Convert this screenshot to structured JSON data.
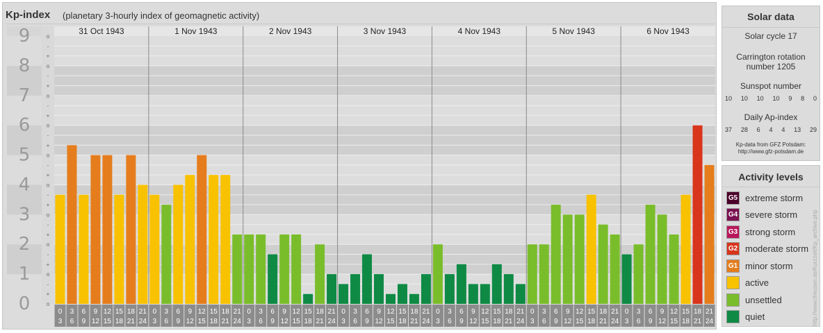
{
  "header": {
    "title": "Kp-index",
    "subtitle": "(planetary 3-hourly index of geomagnetic activity)"
  },
  "chart_data": {
    "type": "bar",
    "title": "Kp-index",
    "subtitle": "(planetary 3-hourly index of geomagnetic activity)",
    "ylim": [
      0,
      9
    ],
    "y_ticks": [
      "0",
      "1",
      "2",
      "3",
      "4",
      "5",
      "6",
      "7",
      "8",
      "9"
    ],
    "minor_tick_labels": [
      "o",
      "+",
      "-",
      "o",
      "+",
      "-",
      "o",
      "+",
      "-",
      "o",
      "+",
      "-",
      "o",
      "+",
      "-",
      "o",
      "+",
      "-",
      "o",
      "+",
      "-",
      "o",
      "+",
      "-",
      "o",
      "+",
      "-",
      "o"
    ],
    "days": [
      "31 Oct 1943",
      "1 Nov 1943",
      "2 Nov 1943",
      "3 Nov 1943",
      "4 Nov 1943",
      "5 Nov 1943",
      "6 Nov 1943"
    ],
    "interval_start_labels": [
      "0",
      "3",
      "6",
      "9",
      "12",
      "15",
      "18",
      "21"
    ],
    "interval_end_labels": [
      "3",
      "6",
      "9",
      "12",
      "15",
      "18",
      "21",
      "24"
    ],
    "values": [
      3.667,
      5.333,
      3.667,
      5.0,
      5.0,
      3.667,
      5.0,
      4.0,
      3.667,
      3.333,
      4.0,
      4.333,
      5.0,
      4.333,
      4.333,
      2.333,
      2.333,
      2.333,
      1.667,
      2.333,
      2.333,
      0.333,
      2.0,
      1.0,
      0.667,
      1.0,
      1.667,
      1.0,
      0.333,
      0.667,
      0.333,
      1.0,
      2.0,
      1.0,
      1.333,
      0.667,
      0.667,
      1.333,
      1.0,
      0.667,
      2.0,
      2.0,
      3.333,
      3.0,
      3.0,
      3.667,
      2.667,
      2.333,
      1.667,
      2.0,
      3.333,
      3.0,
      2.333,
      3.667,
      6.0,
      4.667
    ],
    "extra_values": [
      4.667
    ],
    "categories_note": "values are Kp per 3-hour interval, 8 per day, in day order",
    "grid": true
  },
  "solar": {
    "heading": "Solar data",
    "cycle": "Solar cycle 17",
    "carrington_1": "Carrington rotation",
    "carrington_2": "number 1205",
    "sunspot_heading": "Sunspot number",
    "sunspot_values": [
      "10",
      "10",
      "10",
      "10",
      "9",
      "8",
      "0"
    ],
    "ap_heading": "Daily Ap-index",
    "ap_values": [
      "37",
      "28",
      "6",
      "4",
      "4",
      "13",
      "29"
    ],
    "source_1": "Kp-data from GFZ Potsdam:",
    "source_2": "http://www.gfz-potsdam.de"
  },
  "levels": {
    "heading": "Activity levels",
    "items": [
      {
        "code": "G5",
        "label": "extreme storm",
        "color": "#4a0029"
      },
      {
        "code": "G4",
        "label": "severe storm",
        "color": "#7a1050"
      },
      {
        "code": "G3",
        "label": "strong storm",
        "color": "#b8175a"
      },
      {
        "code": "G2",
        "label": "moderate storm",
        "color": "#d8351c"
      },
      {
        "code": "G1",
        "label": "minor storm",
        "color": "#e57d1d"
      },
      {
        "code": "",
        "label": "active",
        "color": "#f8c200"
      },
      {
        "code": "",
        "label": "unsettled",
        "color": "#7abd2b"
      },
      {
        "code": "",
        "label": "quiet",
        "color": "#0f8a45"
      }
    ]
  },
  "vertical_note": "http://www.theusen.de/Kurzzeit/Kp_archive.php"
}
